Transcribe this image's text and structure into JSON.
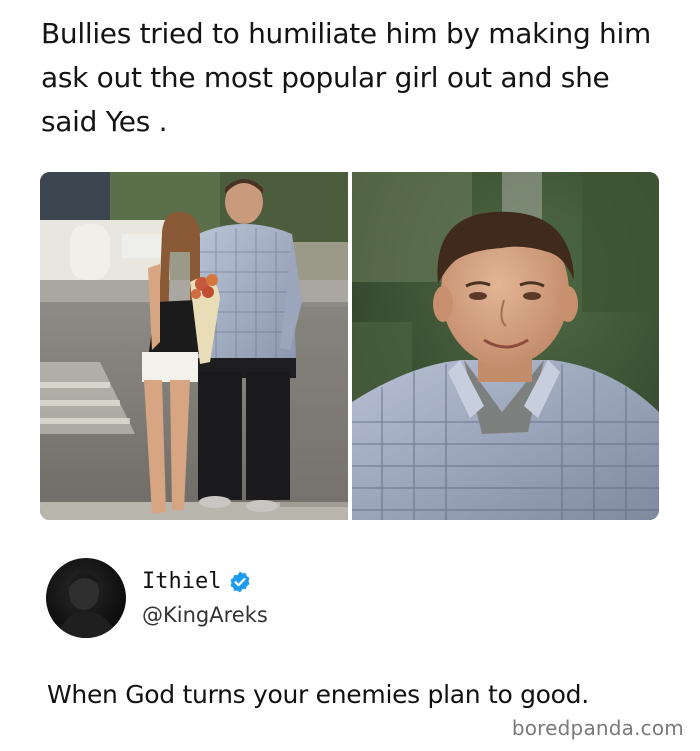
{
  "post": {
    "headline": "Bullies tried to humiliate him by making him ask out the most popular girl out and she said Yes .",
    "photos": [
      {
        "name": "couple-photo",
        "alt": ""
      },
      {
        "name": "portrait-photo",
        "alt": ""
      }
    ]
  },
  "author": {
    "display_name": "Ithiel",
    "handle": "@KingAreks",
    "verified_icon": "verified-check-icon",
    "verified_color": "#1d9bf0"
  },
  "tweet": {
    "text": "When God turns your enemies plan to good."
  },
  "watermark": {
    "text": "boredpanda.com"
  }
}
